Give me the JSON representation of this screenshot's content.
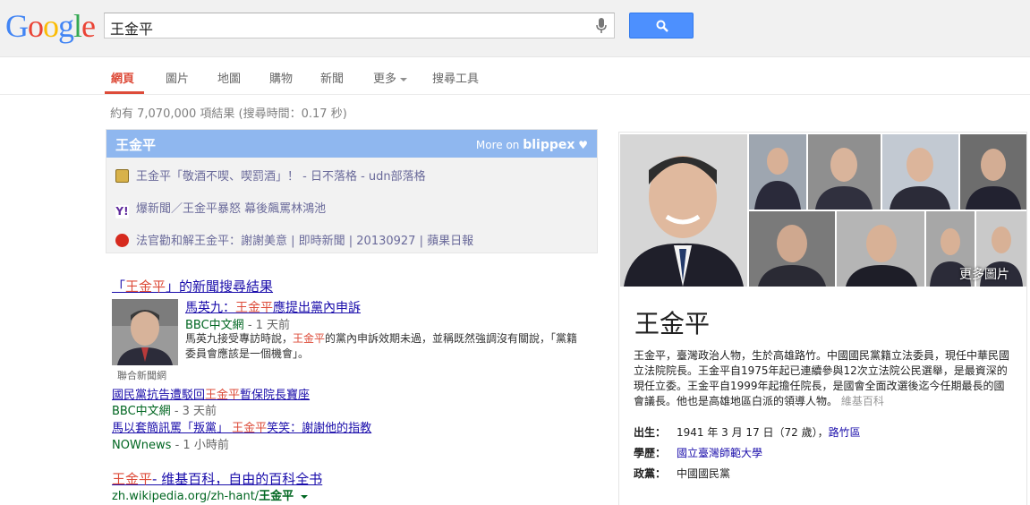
{
  "search": {
    "query": "王金平"
  },
  "nav": {
    "tabs": [
      {
        "label": "網頁"
      },
      {
        "label": "圖片"
      },
      {
        "label": "地圖"
      },
      {
        "label": "購物"
      },
      {
        "label": "新聞"
      },
      {
        "label": "更多"
      },
      {
        "label": "搜尋工具"
      }
    ]
  },
  "stats": "約有 7,070,000 項結果 (搜尋時間：0.17 秒)",
  "blippex": {
    "title": "王金平",
    "more_prefix": "More on",
    "brand": "blippex",
    "items": [
      {
        "text": "王金平「敬酒不喫、喫罰酒」！ - 日不落格 - udn部落格"
      },
      {
        "text": "爆新聞／王金平暴怒 幕後飆罵林鴻池"
      },
      {
        "text": "法官勸和解王金平：謝謝美意 | 即時新聞 | 20130927 | 蘋果日報"
      }
    ]
  },
  "news": {
    "heading_pre": "「",
    "heading_red": "王金平",
    "heading_post": "」的新聞搜尋結果",
    "thumb_caption": "聯合新聞網",
    "top": {
      "title_pre": "馬英九：",
      "title_red": "王金平",
      "title_post": "應提出黨內申訴",
      "source": "BBC中文網",
      "age": " - 1 天前",
      "snippet_pre": "馬英九接受專訪時說，",
      "snippet_red": "王金平",
      "snippet_post": "的黨內申訴效期未過，並稱既然強調沒有關說，「黨籍委員會應該是一個機會」。"
    },
    "others": [
      {
        "title_pre": "國民黨抗告遭駁回",
        "title_red": "王金平",
        "title_post": "暫保院長寶座",
        "source": "BBC中文網",
        "age": " - 3 天前"
      },
      {
        "title_pre": "馬以套簡訊罵「叛黨」 ",
        "title_red": "王金平",
        "title_post": "笑笑：謝謝他的指教",
        "source": "NOWnews",
        "age": " - 1 小時前"
      }
    ]
  },
  "wiki": {
    "title_red": "王金平",
    "title_post": "- 维基百科，自由的百科全书",
    "url_pre": "zh.wikipedia.org/zh-hant/",
    "url_bold": "王金平"
  },
  "knowledge_panel": {
    "more_images": "更多圖片",
    "name": "王金平",
    "description": "王金平，臺灣政治人物，生於高雄路竹。中國國民黨籍立法委員，現任中華民國立法院院長。王金平自1975年起已連續參與12次立法院公民選舉，是最資深的現任立委。王金平自1999年起擔任院長，是國會全面改選後迄今任期最長的國會議長。他也是高雄地區白派的領導人物。",
    "source": "維基百科",
    "facts": [
      {
        "label": "出生：",
        "value": "1941 年 3 月 17 日（72 歲），",
        "link": "路竹區"
      },
      {
        "label": "學歷：",
        "value": "",
        "link": "國立臺灣師範大學"
      },
      {
        "label": "政黨：",
        "value": "中國國民黨",
        "link": ""
      }
    ]
  },
  "colors": {
    "accent_red": "#dd4b39",
    "link_blue": "#1a0dab",
    "url_green": "#006621",
    "search_blue": "#4d90fe",
    "blippex_blue": "#8fb7ef"
  }
}
